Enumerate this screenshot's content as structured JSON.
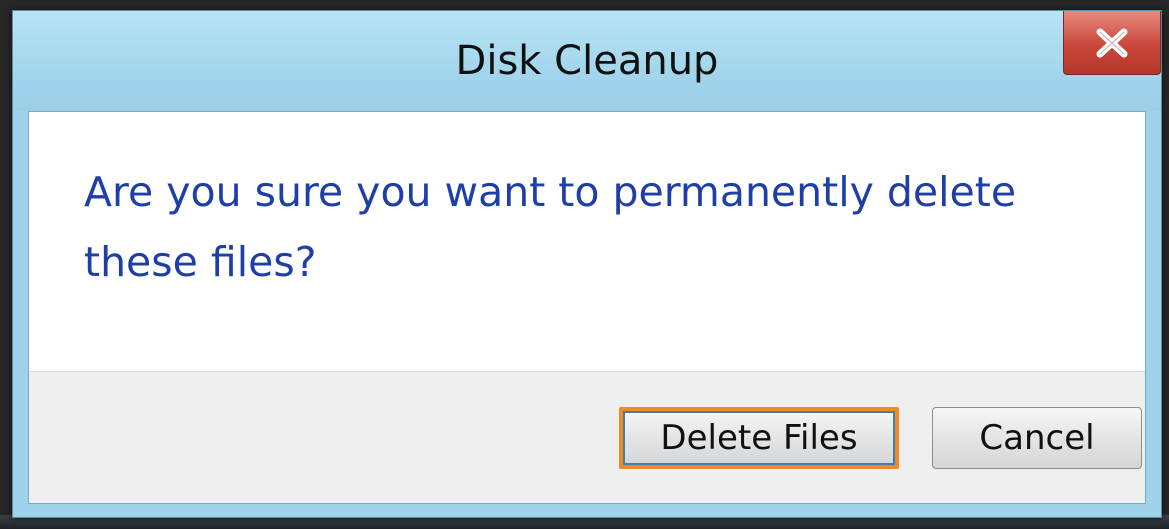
{
  "window": {
    "title": "Disk Cleanup",
    "close_icon": "close-icon"
  },
  "dialog": {
    "message": "Are you sure you want to permanently delete these files?"
  },
  "buttons": {
    "delete_label": "Delete Files",
    "cancel_label": "Cancel"
  },
  "colors": {
    "message_text": "#1f3fa8",
    "focus_highlight": "#f08a24",
    "close_button": "#c9463a",
    "titlebar": "#a3d6ec"
  }
}
